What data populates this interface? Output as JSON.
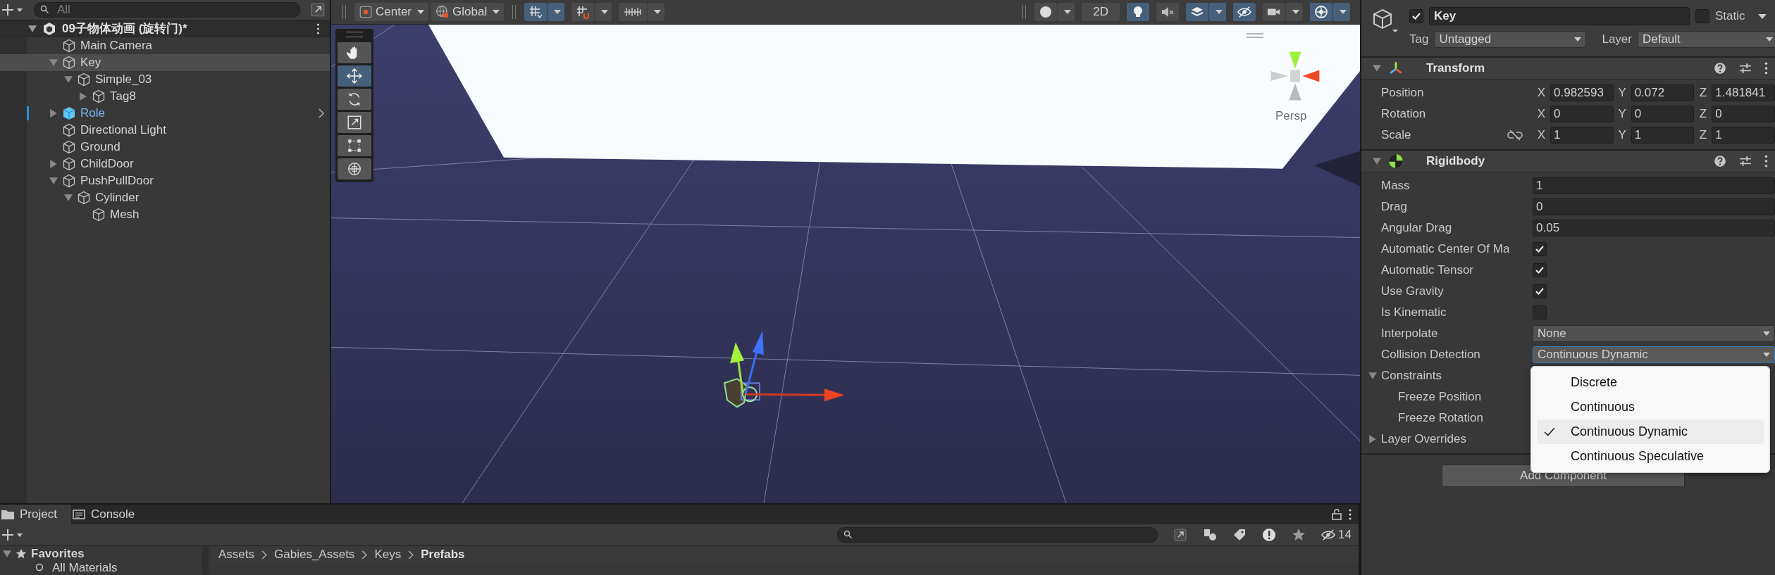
{
  "hierarchy": {
    "search": {
      "placeholder": "All"
    },
    "scene": {
      "title": "09子物体动画 (旋转门)*",
      "expanded": true
    },
    "items": [
      {
        "name": "Main Camera",
        "kind": "object",
        "selected": false
      },
      {
        "name": "Key",
        "kind": "object",
        "selected": true,
        "expanded": true,
        "children": [
          {
            "name": "Simple_03",
            "kind": "object",
            "selected": false,
            "expanded": true,
            "children": [
              {
                "name": "Tag8",
                "kind": "object",
                "selected": false,
                "expanded": false
              }
            ]
          }
        ]
      },
      {
        "name": "Role",
        "kind": "prefab",
        "selected": false,
        "expanded": false
      },
      {
        "name": "Directional Light",
        "kind": "object",
        "selected": false
      },
      {
        "name": "Ground",
        "kind": "object",
        "selected": false
      },
      {
        "name": "ChildDoor",
        "kind": "object",
        "selected": false,
        "expanded": false
      },
      {
        "name": "PushPullDoor",
        "kind": "object",
        "selected": false,
        "expanded": true,
        "children": [
          {
            "name": "Cylinder",
            "kind": "object",
            "selected": false,
            "expanded": true,
            "children": [
              {
                "name": "Mesh",
                "kind": "object",
                "selected": false
              }
            ]
          }
        ]
      }
    ]
  },
  "scene_toolbar": {
    "pivot": "Center",
    "space": "Global",
    "snap_buttons": [
      {
        "on": true,
        "dropdown": true
      },
      {
        "on": false,
        "dropdown": true
      },
      {
        "on": false,
        "dropdown": true
      }
    ],
    "view_buttons": [
      {
        "on": false,
        "dropdown": true
      },
      {
        "label": "2D",
        "on": false
      },
      {
        "on": true
      },
      {
        "on": false
      },
      {
        "on": true,
        "dropdown": true
      },
      {
        "on": true
      },
      {
        "on": false,
        "dropdown": true
      },
      {
        "on": true,
        "dropdown": true
      }
    ]
  },
  "scene": {
    "tools": [
      {
        "selected": false
      },
      {
        "selected": true
      },
      {
        "selected": false
      },
      {
        "selected": false
      },
      {
        "selected": false
      },
      {
        "selected": false
      }
    ],
    "camera_label": "Persp"
  },
  "inspector": {
    "active": true,
    "name": "Key",
    "static": false,
    "static_label": "Static",
    "tag_label": "Tag",
    "tag": "Untagged",
    "layer_label": "Layer",
    "layer": "Default",
    "components": [
      {
        "kind": "transform",
        "title": "Transform",
        "rows": [
          {
            "label": "Position",
            "fields": [
              {
                "axis": "X",
                "value": "0.982593"
              },
              {
                "axis": "Y",
                "value": "0.072"
              },
              {
                "axis": "Z",
                "value": "1.481841"
              }
            ]
          },
          {
            "label": "Rotation",
            "fields": [
              {
                "axis": "X",
                "value": "0"
              },
              {
                "axis": "Y",
                "value": "0"
              },
              {
                "axis": "Z",
                "value": "0"
              }
            ]
          },
          {
            "label": "Scale",
            "proportions_locked": false,
            "fields": [
              {
                "axis": "X",
                "value": "1"
              },
              {
                "axis": "Y",
                "value": "1"
              },
              {
                "axis": "Z",
                "value": "1"
              }
            ]
          }
        ]
      },
      {
        "kind": "rigidbody",
        "title": "Rigidbody",
        "rows": [
          {
            "kind": "number",
            "label": "Mass",
            "value": "1"
          },
          {
            "kind": "number",
            "label": "Drag",
            "value": "0"
          },
          {
            "kind": "number",
            "label": "Angular Drag",
            "value": "0.05"
          },
          {
            "kind": "checkbox",
            "label": "Automatic Center Of Ma",
            "checked": true
          },
          {
            "kind": "checkbox",
            "label": "Automatic Tensor",
            "checked": true
          },
          {
            "kind": "checkbox",
            "label": "Use Gravity",
            "checked": true
          },
          {
            "kind": "checkbox",
            "label": "Is Kinematic",
            "checked": false
          },
          {
            "kind": "dropdown",
            "label": "Interpolate",
            "value": "None"
          },
          {
            "kind": "dropdown",
            "label": "Collision Detection",
            "value": "Continuous Dynamic",
            "open": true,
            "options": [
              {
                "label": "Discrete",
                "selected": false
              },
              {
                "label": "Continuous",
                "selected": false
              },
              {
                "label": "Continuous Dynamic",
                "selected": true
              },
              {
                "label": "Continuous Speculative",
                "selected": false
              }
            ]
          },
          {
            "kind": "group",
            "label": "Constraints",
            "expanded": true,
            "children": [
              {
                "label": "Freeze Position"
              },
              {
                "label": "Freeze Rotation"
              }
            ]
          },
          {
            "kind": "group",
            "label": "Layer Overrides",
            "expanded": false
          }
        ]
      }
    ],
    "add_component": "Add Component"
  },
  "project": {
    "tabs": [
      {
        "label": "Project",
        "selected": true
      },
      {
        "label": "Console",
        "selected": false
      }
    ],
    "hidden_count": "14",
    "favorites": {
      "label": "Favorites",
      "expanded": true,
      "items": [
        "All Materials"
      ]
    },
    "breadcrumb": [
      "Assets",
      "Gabies_Assets",
      "Keys",
      "Prefabs"
    ]
  }
}
